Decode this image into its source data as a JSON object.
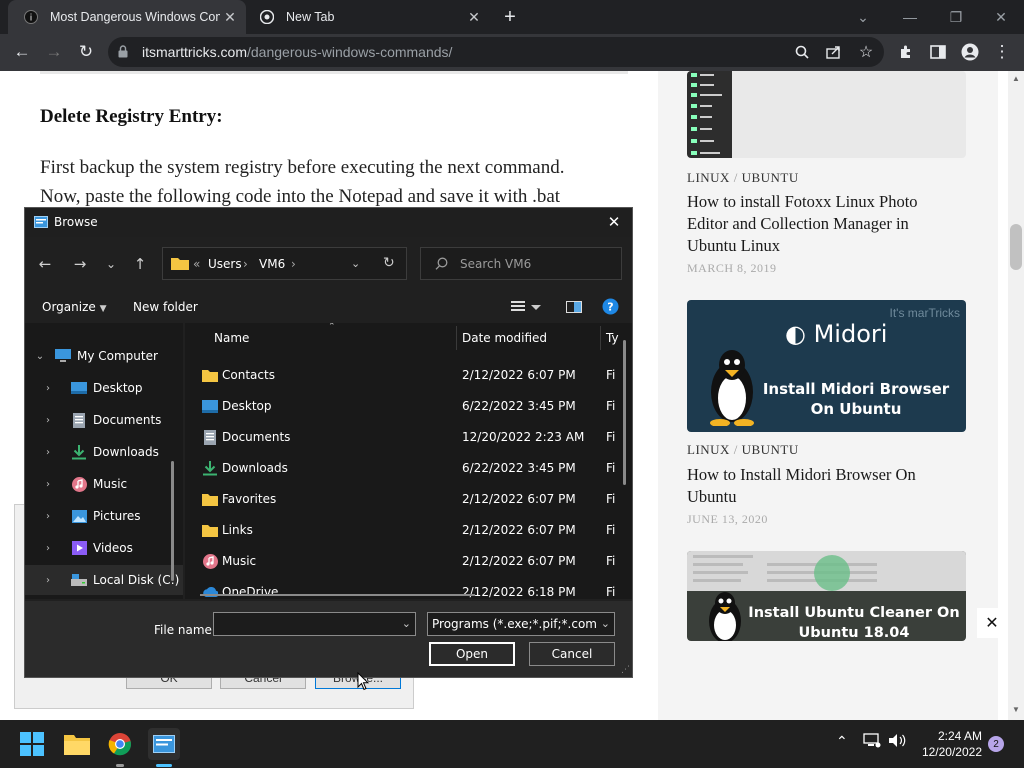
{
  "browser": {
    "tabs": [
      {
        "title": "Most Dangerous Windows Comm",
        "active": true
      },
      {
        "title": "New Tab",
        "active": false
      }
    ],
    "url_domain": "itsmarttricks.com",
    "url_path": "/dangerous-windows-commands/"
  },
  "article": {
    "heading": "Delete Registry Entry:",
    "para_line1": "First backup the system registry before executing the next command.",
    "para_line2": "Now, paste the following code into the Notepad and save it with .bat"
  },
  "sidebar": {
    "posts": [
      {
        "category_a": "LINUX",
        "sep": "/",
        "category_b": "UBUNTU",
        "title": "How to install Fotoxx Linux Photo Editor and Collection Manager in Ubuntu Linux",
        "date": "MARCH 8, 2019"
      },
      {
        "image_brand": "Midori",
        "image_caption": "Install Midori Browser On Ubuntu",
        "watermark": "It's marTricks",
        "category_a": "LINUX",
        "sep": "/",
        "category_b": "UBUNTU",
        "title": "How to Install Midori Browser On Ubuntu",
        "date": "JUNE 13, 2020"
      },
      {
        "image_caption": "Install Ubuntu Cleaner On Ubuntu 18.04"
      }
    ]
  },
  "background_dialog": {
    "buttons": [
      "OK",
      "Cancel",
      "Browse..."
    ]
  },
  "dialog": {
    "title": "Browse",
    "breadcrumb": {
      "prefix": "«",
      "parts": [
        "Users",
        "VM6"
      ]
    },
    "search_placeholder": "Search VM6",
    "organize": "Organize",
    "new_folder": "New folder",
    "tree": [
      {
        "label": "My Computer",
        "expanded": true
      },
      {
        "label": "Desktop"
      },
      {
        "label": "Documents"
      },
      {
        "label": "Downloads"
      },
      {
        "label": "Music"
      },
      {
        "label": "Pictures"
      },
      {
        "label": "Videos"
      },
      {
        "label": "Local Disk (C:)"
      }
    ],
    "columns": {
      "name": "Name",
      "date": "Date modified",
      "type": "Ty"
    },
    "files": [
      {
        "name": "Contacts",
        "date": "2/12/2022 6:07 PM",
        "type": "Fi",
        "icon": "folder-icon"
      },
      {
        "name": "Desktop",
        "date": "6/22/2022 3:45 PM",
        "type": "Fi",
        "icon": "desktop-icon"
      },
      {
        "name": "Documents",
        "date": "12/20/2022 2:23 AM",
        "type": "Fi",
        "icon": "documents-icon"
      },
      {
        "name": "Downloads",
        "date": "6/22/2022 3:45 PM",
        "type": "Fi",
        "icon": "downloads-icon"
      },
      {
        "name": "Favorites",
        "date": "2/12/2022 6:07 PM",
        "type": "Fi",
        "icon": "folder-icon"
      },
      {
        "name": "Links",
        "date": "2/12/2022 6:07 PM",
        "type": "Fi",
        "icon": "folder-icon"
      },
      {
        "name": "Music",
        "date": "2/12/2022 6:07 PM",
        "type": "Fi",
        "icon": "music-icon"
      },
      {
        "name": "OneDrive",
        "date": "2/12/2022 6:18 PM",
        "type": "Fi",
        "icon": "onedrive-icon"
      }
    ],
    "file_name_label": "File name:",
    "file_name_value": "",
    "filter": "Programs (*.exe;*.pif;*.com;*.bat)",
    "open": "Open",
    "cancel": "Cancel"
  },
  "taskbar": {
    "time": "2:24 AM",
    "date": "12/20/2022",
    "notifications": "2"
  },
  "colors": {
    "chrome_dark": "#202124",
    "dialog_bg": "#202020",
    "taskbar": "#202020",
    "folder_yellow": "#f4c542",
    "accent_blue": "#0a84ff"
  }
}
